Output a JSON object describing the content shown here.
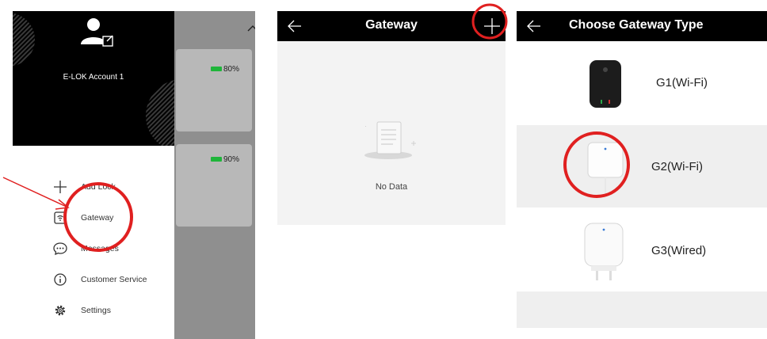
{
  "drawer": {
    "account_name": "E-LOK Account 1",
    "menu": [
      {
        "label": "Add Lock",
        "icon": "plus-icon"
      },
      {
        "label": "Gateway",
        "icon": "gateway-icon"
      },
      {
        "label": "Messages",
        "icon": "message-icon"
      },
      {
        "label": "Customer Service",
        "icon": "info-icon"
      },
      {
        "label": "Settings",
        "icon": "gear-icon"
      }
    ],
    "locks": [
      {
        "battery": "80%",
        "battery_level": 0.8
      },
      {
        "battery": "90%",
        "battery_level": 0.9
      }
    ]
  },
  "gateway_screen": {
    "title": "Gateway",
    "empty_text": "No Data"
  },
  "choose_type_screen": {
    "title": "Choose Gateway Type",
    "options": [
      {
        "label": "G1(Wi-Fi)",
        "icon": "g1-gateway-device-icon"
      },
      {
        "label": "G2(Wi-Fi)",
        "icon": "g2-gateway-device-icon"
      },
      {
        "label": "G3(Wired)",
        "icon": "g3-gateway-device-icon"
      }
    ]
  },
  "colors": {
    "header_bg": "#000000",
    "annotation_red": "#e02020",
    "battery_green": "#1fb53a",
    "selected_row": "#efefef"
  }
}
